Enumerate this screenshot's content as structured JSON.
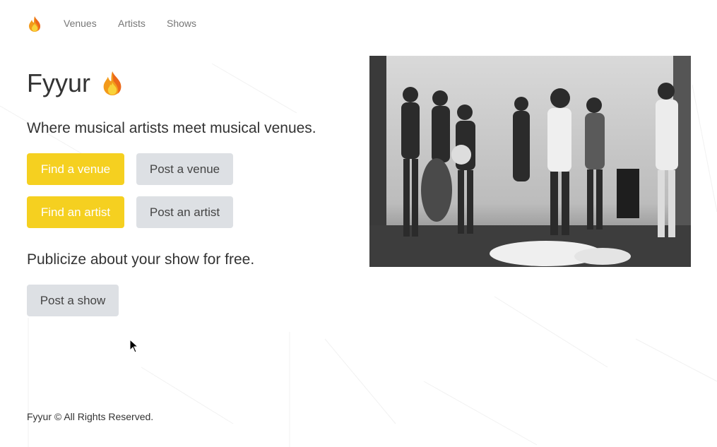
{
  "nav": {
    "brand_icon": "flame-icon",
    "items": [
      {
        "label": "Venues"
      },
      {
        "label": "Artists"
      },
      {
        "label": "Shows"
      }
    ]
  },
  "hero": {
    "title": "Fyyur",
    "title_icon": "flame-icon",
    "tagline": "Where musical artists meet musical venues.",
    "buttons": {
      "find_venue": "Find a venue",
      "post_venue": "Post a venue",
      "find_artist": "Find an artist",
      "post_artist": "Post an artist"
    },
    "publicize": "Publicize about your show for free.",
    "post_show": "Post a show",
    "image_description": "photo-of-bluegrass-band"
  },
  "footer": {
    "text": "Fyyur © All Rights Reserved."
  },
  "colors": {
    "accent": "#f5d020",
    "secondary_button": "#dde0e4",
    "nav_text": "#777777"
  }
}
